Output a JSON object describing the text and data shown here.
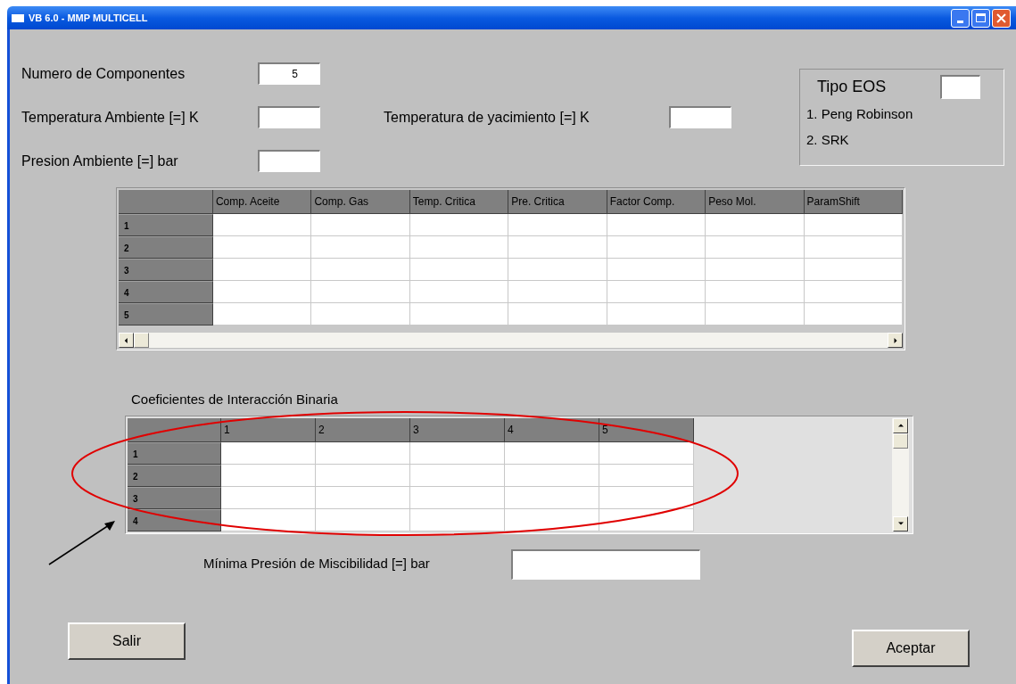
{
  "window": {
    "title": "VB 6.0 - MMP MULTICELL"
  },
  "field_rows": [
    [
      {
        "label": "Numero de Componentes",
        "value": "5"
      }
    ],
    [
      {
        "label": "Temperatura Ambiente [=] K"
      },
      {
        "label": "Temperatura de yacimiento [=] K"
      }
    ],
    [
      {
        "label": "Presion Ambiente [=] bar"
      }
    ]
  ],
  "eos": {
    "title": "Tipo EOS",
    "options": [
      "1. Peng Robinson",
      "2. SRK"
    ]
  },
  "properties_grid": {
    "columns": [
      "Comp. Aceite",
      "Comp. Gas",
      "Temp. Critica",
      "Pre. Critica",
      "Factor Comp.",
      "Peso Mol.",
      "ParamShift"
    ],
    "row_headers": [
      "1",
      "2",
      "3",
      "4",
      "5"
    ]
  },
  "binary_grid": {
    "title": "Coeficientes de Interacción Binaria",
    "columns": [
      "1",
      "2",
      "3",
      "4",
      "5"
    ],
    "row_headers": [
      "1",
      "2",
      "3",
      "4"
    ]
  },
  "mmp_field": {
    "label": "Mínima Presión de Miscibilidad [=] bar"
  },
  "buttons": [
    {
      "label": "Salir"
    },
    {
      "label": "Aceptar"
    }
  ]
}
